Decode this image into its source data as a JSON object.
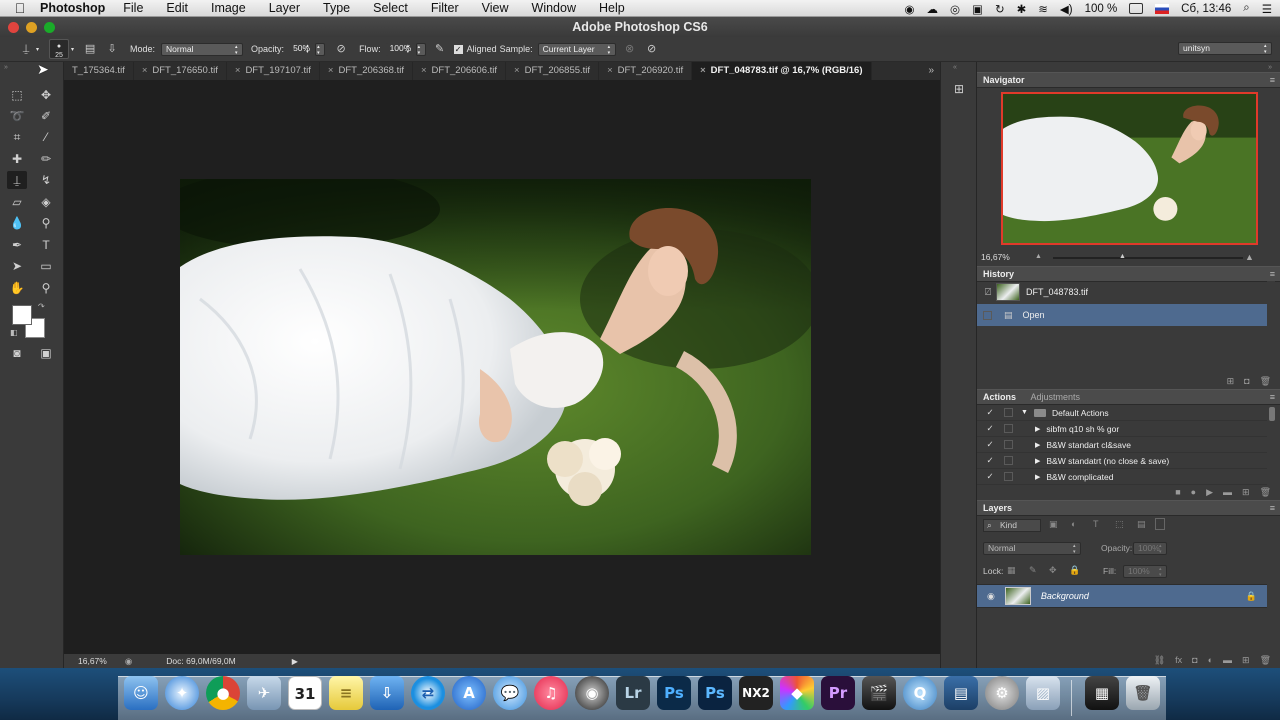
{
  "menubar": {
    "app_name": "Photoshop",
    "items": [
      "File",
      "Edit",
      "Image",
      "Layer",
      "Type",
      "Select",
      "Filter",
      "View",
      "Window",
      "Help"
    ],
    "battery": "100 %",
    "clock": "Сб, 13:46"
  },
  "window": {
    "title": "Adobe Photoshop CS6"
  },
  "options": {
    "brush_size": "25",
    "mode_label": "Mode:",
    "mode_value": "Normal",
    "opacity_label": "Opacity:",
    "opacity_value": "50%",
    "flow_label": "Flow:",
    "flow_value": "100%",
    "aligned_label": "Aligned",
    "sample_label": "Sample:",
    "sample_value": "Current Layer",
    "workspace": "unitsyn"
  },
  "tabs": [
    {
      "label": "T_175364.tif"
    },
    {
      "label": "DFT_176650.tif"
    },
    {
      "label": "DFT_197107.tif"
    },
    {
      "label": "DFT_206368.tif"
    },
    {
      "label": "DFT_206606.tif"
    },
    {
      "label": "DFT_206855.tif"
    },
    {
      "label": "DFT_206920.tif"
    },
    {
      "label": "DFT_048783.tif @ 16,7% (RGB/16)"
    }
  ],
  "status": {
    "zoom": "16,67%",
    "doc": "Doc: 69,0M/69,0M"
  },
  "navigator": {
    "title": "Navigator",
    "zoom": "16,67%"
  },
  "history": {
    "title": "History",
    "snapshot": "DFT_048783.tif",
    "items": [
      "Open"
    ]
  },
  "actions": {
    "tab_actions": "Actions",
    "tab_adjustments": "Adjustments",
    "set_name": "Default Actions",
    "items": [
      "sibfm q10 sh % gor",
      "B&W standart cl&save",
      "B&W standatrt (no close & save)",
      "B&W complicated"
    ]
  },
  "layers": {
    "title": "Layers",
    "filter": "Kind",
    "blend": "Normal",
    "opacity_label": "Opacity:",
    "opacity_value": "100%",
    "lock_label": "Lock:",
    "fill_label": "Fill:",
    "fill_value": "100%",
    "layer_name": "Background"
  },
  "dock": {
    "calendar_day": "31",
    "lr": "Lr",
    "ps": "Ps",
    "nx": "NX2",
    "pr": "Pr"
  },
  "colors": {
    "accent_selection": "#4e6a8f",
    "navigator_frame": "#e03a2a"
  }
}
